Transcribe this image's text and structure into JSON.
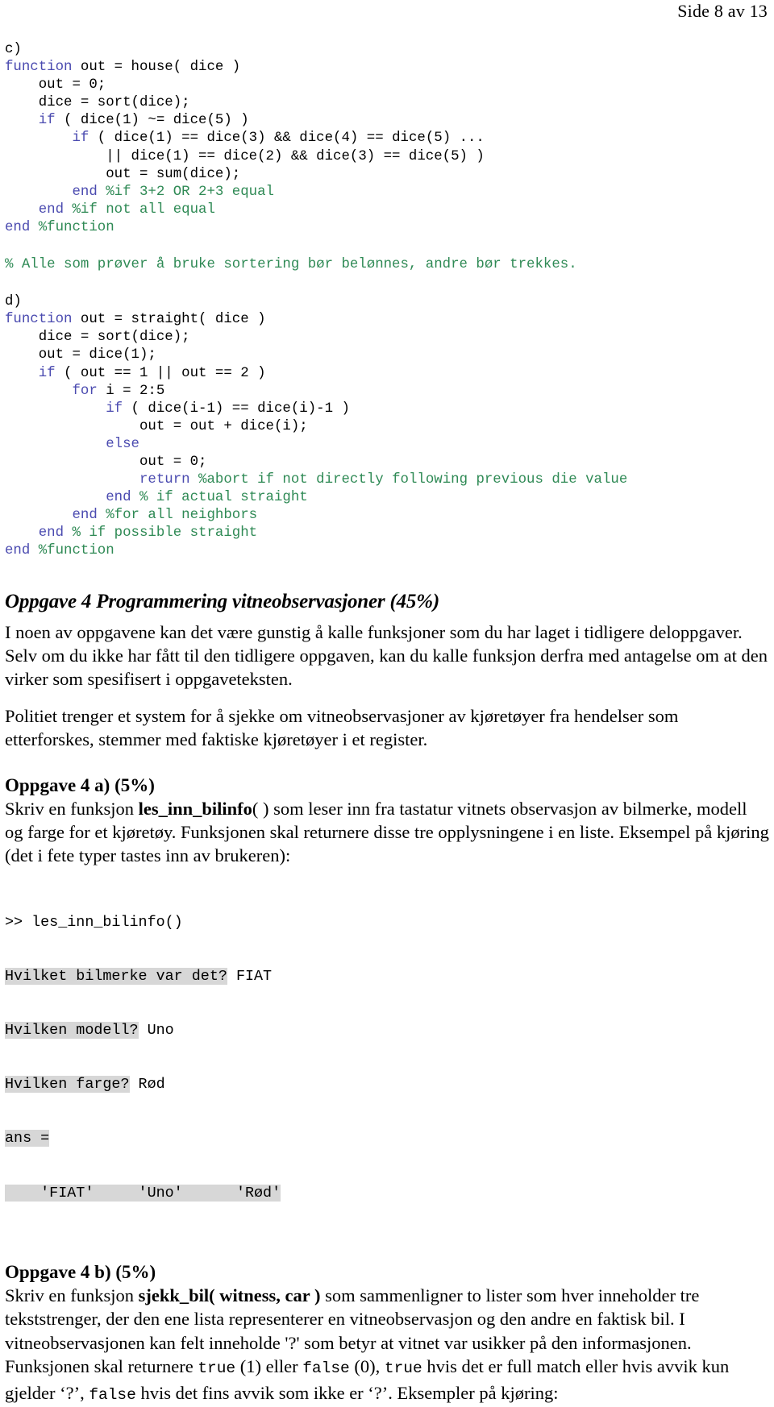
{
  "header": {
    "page_label": "Side 8 av 13"
  },
  "code_c": {
    "label": "c)",
    "lines": [
      [
        {
          "t": "c)",
          "c": "pl"
        }
      ],
      [
        {
          "t": "function",
          "c": "kw"
        },
        {
          "t": " out = house( dice )",
          "c": "pl"
        }
      ],
      [
        {
          "t": "    out = 0;",
          "c": "pl"
        }
      ],
      [
        {
          "t": "    dice = sort(dice);",
          "c": "pl"
        }
      ],
      [
        {
          "t": "    ",
          "c": "pl"
        },
        {
          "t": "if",
          "c": "kw"
        },
        {
          "t": " ( dice(1) ~= dice(5) )",
          "c": "pl"
        }
      ],
      [
        {
          "t": "        ",
          "c": "pl"
        },
        {
          "t": "if",
          "c": "kw"
        },
        {
          "t": " ( dice(1) == dice(3) && dice(4) == dice(5) ...",
          "c": "pl"
        }
      ],
      [
        {
          "t": "            || dice(1) == dice(2) && dice(3) == dice(5) )",
          "c": "pl"
        }
      ],
      [
        {
          "t": "            out = sum(dice);",
          "c": "pl"
        }
      ],
      [
        {
          "t": "        ",
          "c": "pl"
        },
        {
          "t": "end",
          "c": "kw"
        },
        {
          "t": " ",
          "c": "pl"
        },
        {
          "t": "%if 3+2 OR 2+3 equal",
          "c": "cm"
        }
      ],
      [
        {
          "t": "    ",
          "c": "pl"
        },
        {
          "t": "end",
          "c": "kw"
        },
        {
          "t": " ",
          "c": "pl"
        },
        {
          "t": "%if not all equal",
          "c": "cm"
        }
      ],
      [
        {
          "t": "end",
          "c": "kw"
        },
        {
          "t": " ",
          "c": "pl"
        },
        {
          "t": "%function",
          "c": "cm"
        }
      ]
    ]
  },
  "comment_note": {
    "lines": [
      [
        {
          "t": "% Alle som prøver å bruke sortering bør belønnes, andre bør trekkes.",
          "c": "cm"
        }
      ]
    ]
  },
  "code_d": {
    "label": "d)",
    "lines": [
      [
        {
          "t": "d)",
          "c": "pl"
        }
      ],
      [
        {
          "t": "function",
          "c": "kw"
        },
        {
          "t": " out = straight( dice )",
          "c": "pl"
        }
      ],
      [
        {
          "t": "    dice = sort(dice);",
          "c": "pl"
        }
      ],
      [
        {
          "t": "    out = dice(1);",
          "c": "pl"
        }
      ],
      [
        {
          "t": "    ",
          "c": "pl"
        },
        {
          "t": "if",
          "c": "kw"
        },
        {
          "t": " ( out == 1 || out == 2 )",
          "c": "pl"
        }
      ],
      [
        {
          "t": "        ",
          "c": "pl"
        },
        {
          "t": "for",
          "c": "kw"
        },
        {
          "t": " i = 2:5",
          "c": "pl"
        }
      ],
      [
        {
          "t": "            ",
          "c": "pl"
        },
        {
          "t": "if",
          "c": "kw"
        },
        {
          "t": " ( dice(i-1) == dice(i)-1 )",
          "c": "pl"
        }
      ],
      [
        {
          "t": "                out = out + dice(i);",
          "c": "pl"
        }
      ],
      [
        {
          "t": "            ",
          "c": "pl"
        },
        {
          "t": "else",
          "c": "kw"
        },
        {
          "t": "",
          "c": "pl"
        }
      ],
      [
        {
          "t": "                out = 0;",
          "c": "pl"
        }
      ],
      [
        {
          "t": "                ",
          "c": "pl"
        },
        {
          "t": "return",
          "c": "kw"
        },
        {
          "t": " ",
          "c": "pl"
        },
        {
          "t": "%abort if not directly following previous die value",
          "c": "cm"
        }
      ],
      [
        {
          "t": "            ",
          "c": "pl"
        },
        {
          "t": "end",
          "c": "kw"
        },
        {
          "t": " ",
          "c": "pl"
        },
        {
          "t": "% if actual straight",
          "c": "cm"
        }
      ],
      [
        {
          "t": "        ",
          "c": "pl"
        },
        {
          "t": "end",
          "c": "kw"
        },
        {
          "t": " ",
          "c": "pl"
        },
        {
          "t": "%for all neighbors",
          "c": "cm"
        }
      ],
      [
        {
          "t": "    ",
          "c": "pl"
        },
        {
          "t": "end",
          "c": "kw"
        },
        {
          "t": " ",
          "c": "pl"
        },
        {
          "t": "% if possible straight",
          "c": "cm"
        }
      ],
      [
        {
          "t": "end",
          "c": "kw"
        },
        {
          "t": " ",
          "c": "pl"
        },
        {
          "t": "%function",
          "c": "cm"
        }
      ]
    ]
  },
  "task4": {
    "heading": "Oppgave 4 Programmering vitneobservasjoner (45%)",
    "intro_p1": "I noen av oppgavene kan det være gunstig å kalle funksjoner som du har laget i tidligere deloppgaver. Selv om du ikke har fått til den tidligere oppgaven, kan du kalle funksjon derfra med antagelse om at den virker som spesifisert i oppgaveteksten.",
    "intro_p2": "Politiet trenger et system for å sjekke om vitneobservasjoner av kjøretøyer fra hendelser som etterforskes, stemmer med faktiske kjøretøyer i et register."
  },
  "task4a": {
    "heading": "Oppgave 4 a) (5%)",
    "body_pre": "Skriv en funksjon ",
    "fn_name": "les_inn_bilinfo",
    "body_post": "( ) som leser inn fra tastatur vitnets observasjon av bilmerke, modell og farge for et kjøretøy.  Funksjonen skal returnere disse tre opplysningene i en liste. Eksempel på kjøring (det i fete typer tastes inn av brukeren):",
    "console": {
      "prompt_line": ">> les_inn_bilinfo()",
      "rows": [
        {
          "prompt": "Hvilket bilmerke var det?",
          "answer": " FIAT"
        },
        {
          "prompt": "Hvilken modell?",
          "answer": " Uno"
        },
        {
          "prompt": "Hvilken farge?",
          "answer": " Rød"
        }
      ],
      "ans_label": "ans =",
      "ans_values": "    'FIAT'     'Uno'      'Rød'"
    }
  },
  "task4b": {
    "heading": "Oppgave 4 b) (5%)",
    "seg1": "Skriv en funksjon ",
    "fn_name": "sjekk_bil( witness, car )",
    "seg2": " som sammenligner to lister som hver inneholder tre tekststrenger, der den ene lista representerer en vitneobservasjon og den andre en faktisk bil. I vitneobservasjonen kan felt inneholde '?' som betyr at vitnet var usikker på den informasjonen. Funksjonen skal returnere ",
    "mono_true_1": "true",
    "seg3": " (1) eller ",
    "mono_false_1": "false",
    "seg4": " (0), ",
    "mono_true_2": "true",
    "seg5": " hvis det er full match eller hvis avvik kun gjelder ‘?’, ",
    "mono_false_2": "false",
    "seg6": " hvis det fins avvik som ikke er ‘?’. Eksempler på kjøring:"
  },
  "colors": {
    "keyword": "#4b4bb0",
    "comment": "#2f8a55",
    "plain": "#000000",
    "highlight": "#d7d7d7",
    "page_bg": "#ffffff"
  }
}
